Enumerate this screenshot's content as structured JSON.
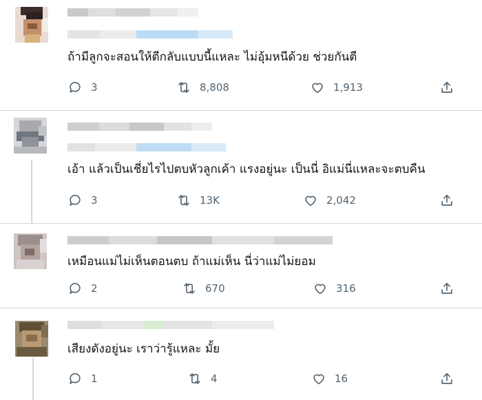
{
  "replies": [
    {
      "text": "ถ้ามีลูกจะสอนให้ตีกลับแบบนี้แหละ ไม่อุ้มหนีด้วย ช่วยกันตี",
      "reply_count": "3",
      "repost_count": "8,808",
      "like_count": "1,913"
    },
    {
      "text": "เอ้า แล้วเป็นเชี่ยไรไปตบหัวลูกเค้า แรงอยู่นะ เป็นนี่ อิแม่นี่แหละจะตบคืน",
      "reply_count": "3",
      "repost_count": "13K",
      "like_count": "2,042"
    },
    {
      "text": "เหมือนแม่ไม่เห็นตอนตบ   ถ้าแม่เห็น นี่ว่าแม่ไม่ยอม",
      "reply_count": "2",
      "repost_count": "670",
      "like_count": "316"
    },
    {
      "text": "เสียงดังอยู่นะ เราว่ารู้แหละ มั้ย",
      "reply_count": "1",
      "repost_count": "4",
      "like_count": "16"
    }
  ],
  "icons": {
    "reply": "reply-bubble-icon",
    "repost": "repost-arrows-icon",
    "like": "heart-icon",
    "share": "share-upload-icon"
  },
  "colors": {
    "icon": "#536471",
    "divider": "#cfd9de",
    "text": "#0f1419",
    "handle_blur": "#a9d4f5"
  }
}
